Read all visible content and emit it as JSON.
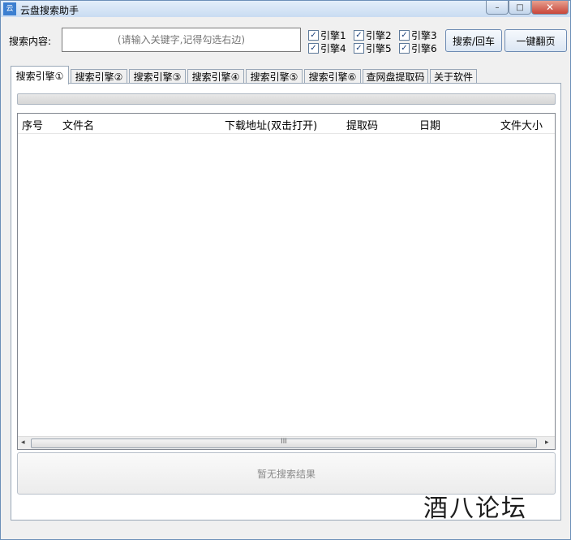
{
  "window": {
    "title": "云盘搜索助手",
    "app_icon_text": "云",
    "controls": {
      "minimize": "–",
      "maximize": "□",
      "close": "✕"
    }
  },
  "search": {
    "label": "搜索内容:",
    "placeholder": "(请输入关键字,记得勾选右边)"
  },
  "engines": [
    {
      "label": "引擎1",
      "checked": true
    },
    {
      "label": "引擎2",
      "checked": true
    },
    {
      "label": "引擎3",
      "checked": true
    },
    {
      "label": "引擎4",
      "checked": true
    },
    {
      "label": "引擎5",
      "checked": true
    },
    {
      "label": "引擎6",
      "checked": true
    }
  ],
  "buttons": {
    "search": "搜索/回车",
    "next_page": "一键翻页"
  },
  "tabs": [
    "搜索引擎①",
    "搜索引擎②",
    "搜索引擎③",
    "搜索引擎④",
    "搜索引擎⑤",
    "搜索引擎⑥",
    "查网盘提取码",
    "关于软件"
  ],
  "active_tab": 0,
  "table": {
    "columns": [
      "序号",
      "文件名",
      "下载地址(双击打开)",
      "提取码",
      "日期",
      "文件大小"
    ],
    "rows": []
  },
  "scrollbar": {
    "left": "◂",
    "right": "▸",
    "grip": "III"
  },
  "status": {
    "text": "暂无搜索结果"
  },
  "watermark": "酒八论坛"
}
